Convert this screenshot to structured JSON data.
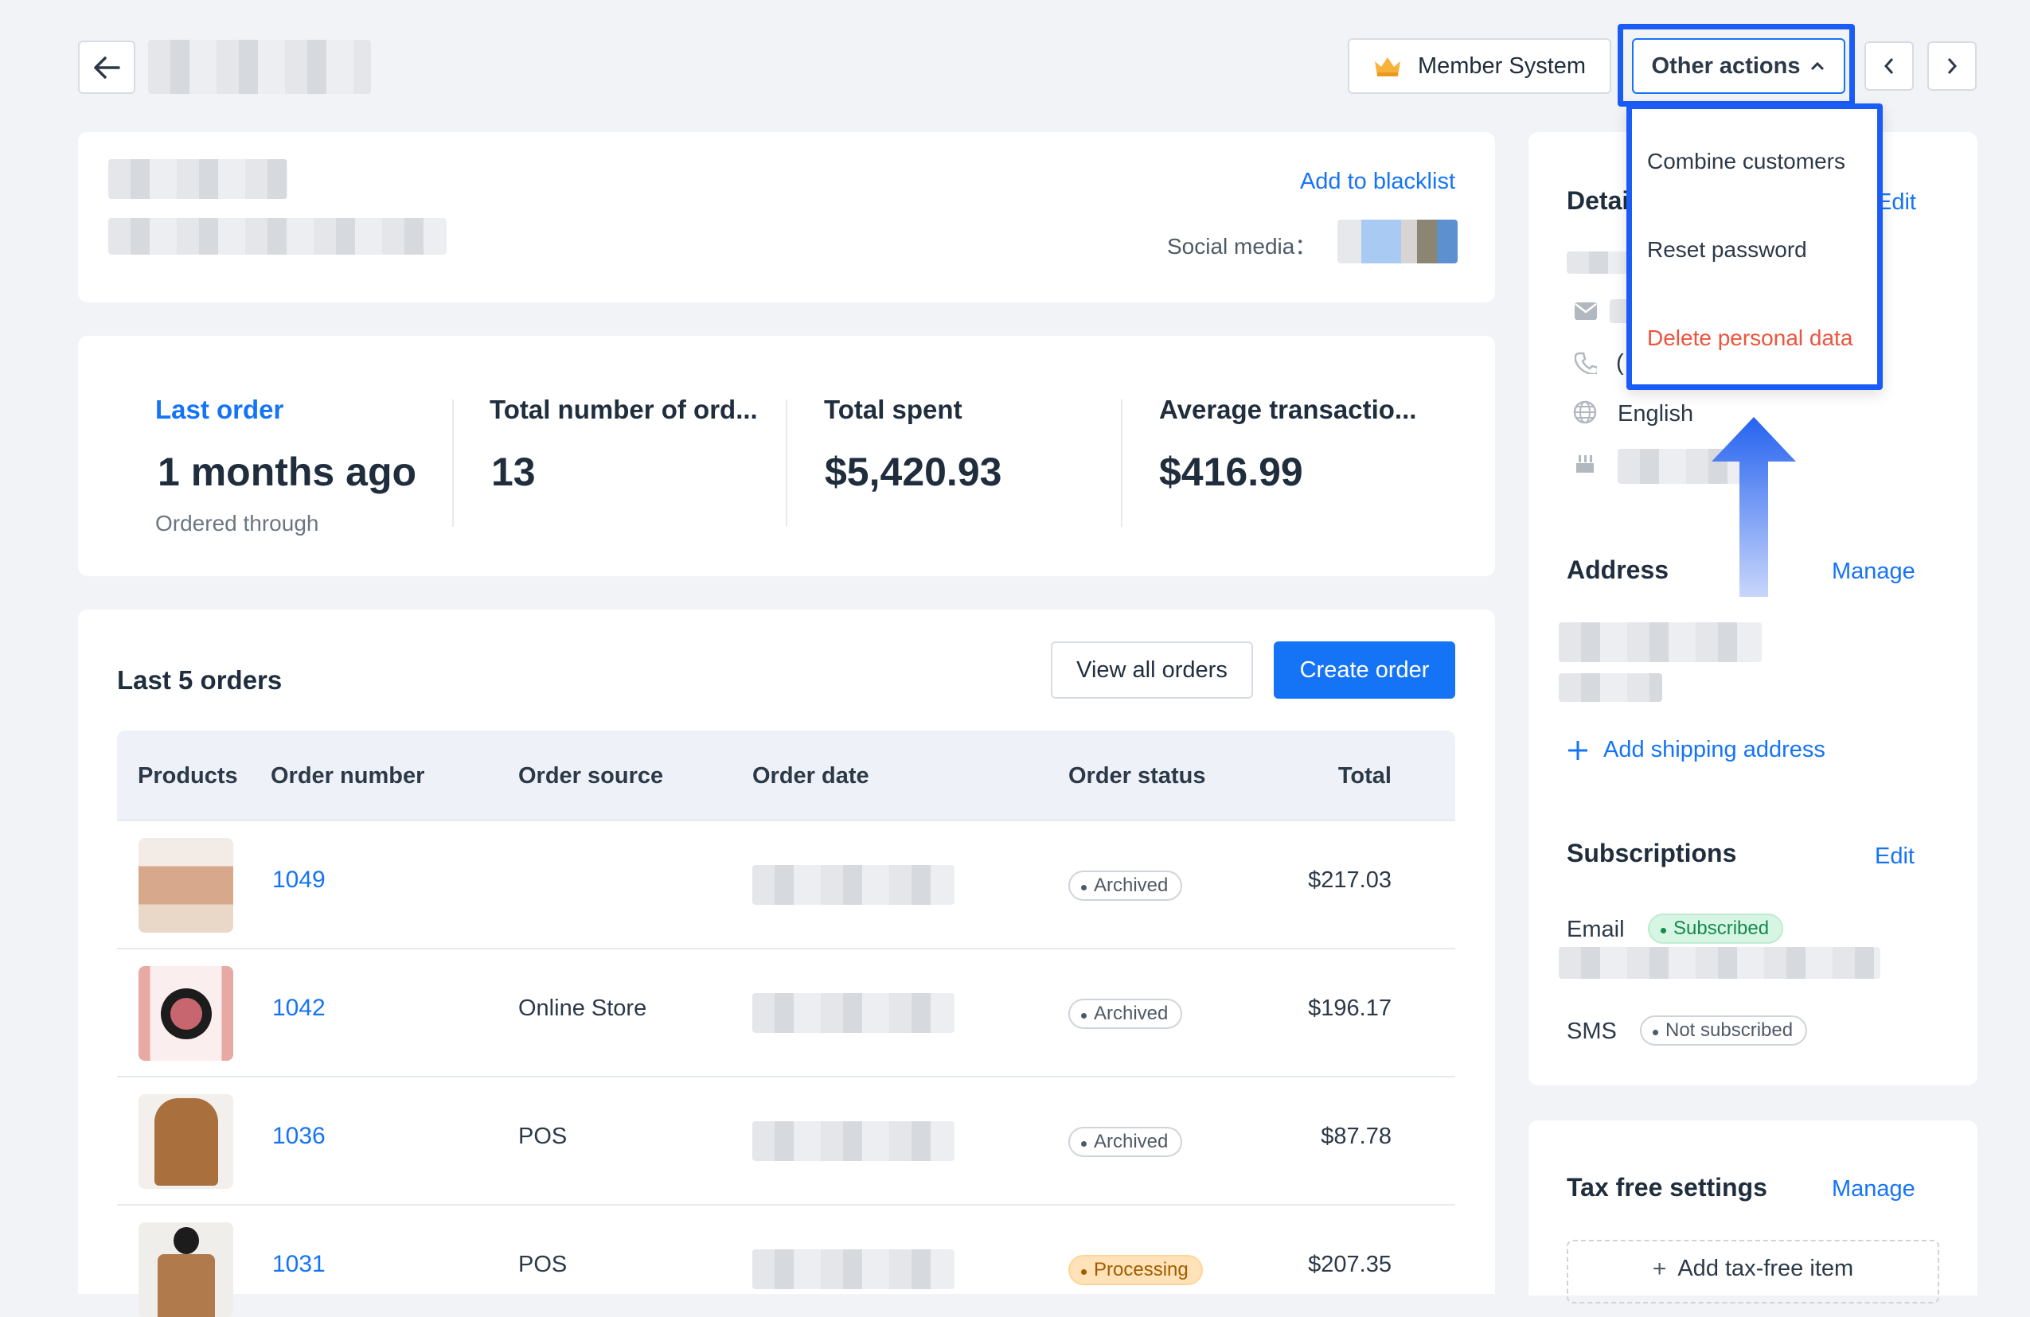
{
  "header": {
    "member_system_label": "Member System",
    "other_actions_label": "Other actions"
  },
  "dropdown": {
    "items": [
      "Combine customers",
      "Reset password",
      "Delete personal data"
    ]
  },
  "profile": {
    "blacklist_label": "Add to blacklist",
    "social_label": "Social media："
  },
  "stats": [
    {
      "title": "Last order",
      "value": "1 months ago",
      "sub": "Ordered through"
    },
    {
      "title": "Total number of ord...",
      "value": "13"
    },
    {
      "title": "Total spent",
      "value": "$5,420.93"
    },
    {
      "title": "Average transactio...",
      "value": "$416.99"
    }
  ],
  "orders": {
    "title": "Last 5 orders",
    "view_all_label": "View all orders",
    "create_label": "Create order",
    "columns": [
      "Products",
      "Order number",
      "Order source",
      "Order date",
      "Order status",
      "Total"
    ],
    "rows": [
      {
        "number": "1049",
        "source": "",
        "status": "Archived",
        "total": "$217.03"
      },
      {
        "number": "1042",
        "source": "Online Store",
        "status": "Archived",
        "total": "$196.17"
      },
      {
        "number": "1036",
        "source": "POS",
        "status": "Archived",
        "total": "$87.78"
      },
      {
        "number": "1031",
        "source": "POS",
        "status": "Processing",
        "total": "$207.35"
      }
    ]
  },
  "sidebar": {
    "details_title": "Detai",
    "details_edit": "Edit",
    "phone_prefix": "(",
    "language": "English",
    "address_title": "Address",
    "address_manage": "Manage",
    "add_shipping": "Add shipping address",
    "subs_title": "Subscriptions",
    "subs_edit": "Edit",
    "email_label": "Email",
    "email_status": "Subscribed",
    "sms_label": "SMS",
    "sms_status": "Not subscribed",
    "tax_title": "Tax free settings",
    "tax_manage": "Manage",
    "add_tax": "Add tax-free item"
  },
  "colors": {
    "accent": "#1574f6",
    "danger": "#f0533c",
    "highlight": "#1a5cf5"
  }
}
